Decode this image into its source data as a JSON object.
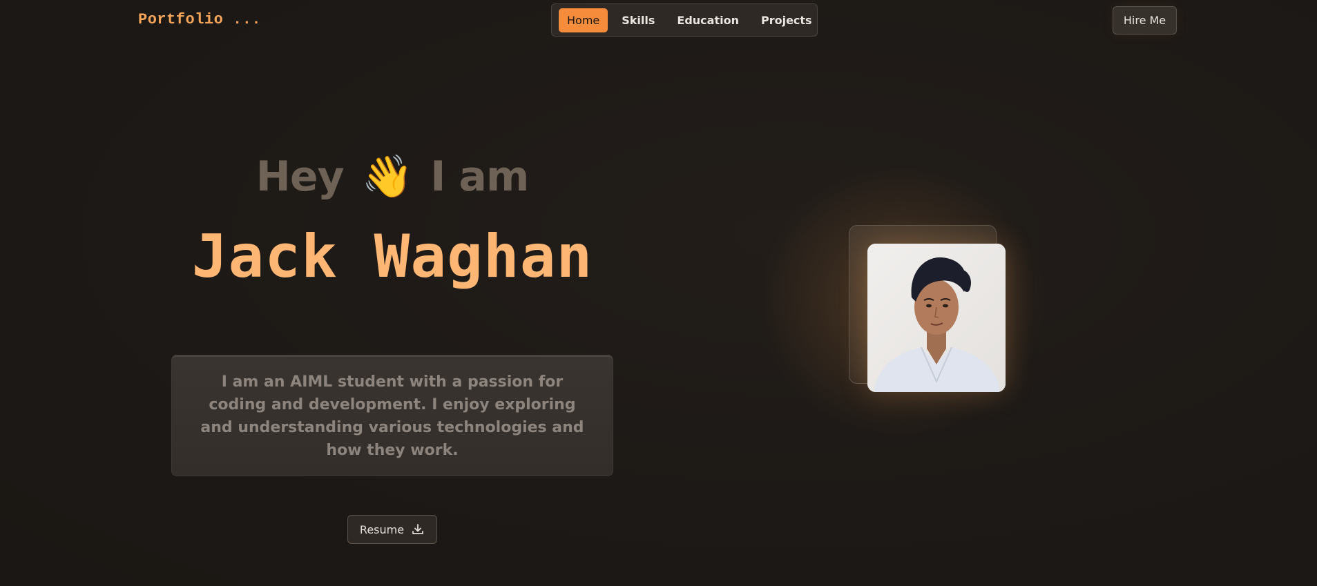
{
  "header": {
    "logo": "Portfolio ...",
    "nav": [
      {
        "label": "Home",
        "active": true
      },
      {
        "label": "Skills",
        "active": false
      },
      {
        "label": "Education",
        "active": false
      },
      {
        "label": "Projects",
        "active": false
      }
    ],
    "hire_label": "Hire Me"
  },
  "hero": {
    "greeting_start": "Hey",
    "wave_emoji": "👋",
    "greeting_end": "I am",
    "name": "Jack Waghan",
    "bio": "I am an AIML student with a passion for coding and development. I enjoy exploring and understanding various technologies and how they work.",
    "resume_label": "Resume",
    "resume_icon": "download-icon",
    "photo_icon": "profile-photo"
  },
  "colors": {
    "accent": "#f58c3c",
    "name": "#fdb673",
    "background": "#1d1916"
  }
}
